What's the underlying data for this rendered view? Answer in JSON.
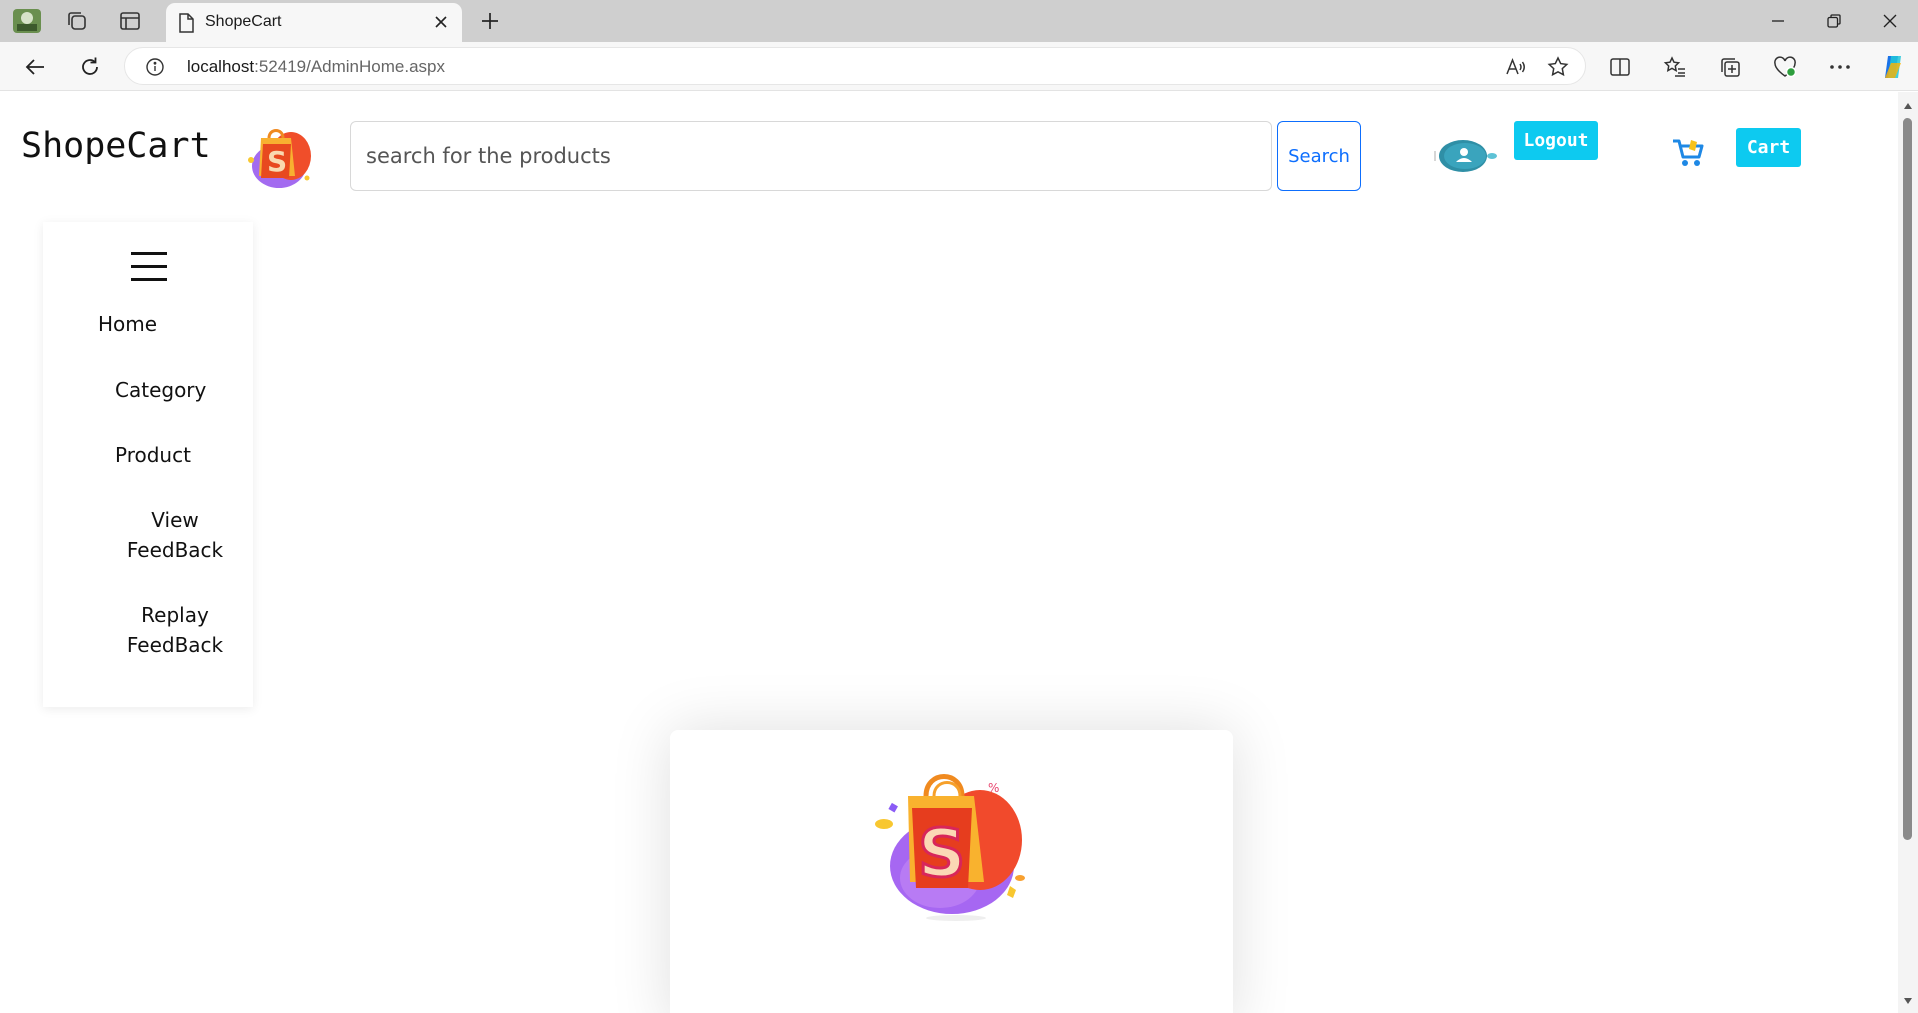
{
  "browser": {
    "tab": {
      "title": "ShopeCart"
    },
    "address": {
      "host": "localhost",
      "path": ":52419/AdminHome.aspx"
    }
  },
  "header": {
    "brand": "ShopeCart",
    "search": {
      "placeholder": "search for the products",
      "button_label": "Search"
    },
    "logout_label": "Logout",
    "cart_label": "Cart"
  },
  "sidebar": {
    "items": [
      {
        "label": "Home"
      },
      {
        "label": "Category"
      },
      {
        "label": "Product"
      },
      {
        "label": "View FeedBack"
      },
      {
        "label": "Replay FeedBack"
      }
    ]
  },
  "colors": {
    "accent_cyan": "#0dcaf0",
    "primary_blue": "#0d6efd"
  }
}
